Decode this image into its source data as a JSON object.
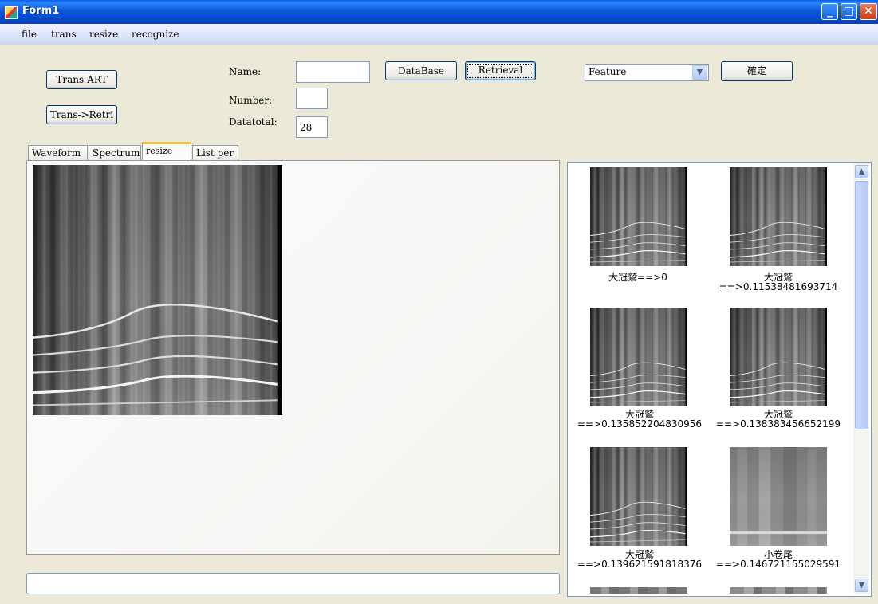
{
  "window": {
    "title": "Form1"
  },
  "menu": [
    "file",
    "trans",
    "resize",
    "recognize"
  ],
  "buttons": {
    "trans_art": "Trans-ART",
    "trans_retri": "Trans->Retri",
    "database": "DataBase",
    "retrieval": "Retrieval",
    "confirm": "確定"
  },
  "fields": {
    "name_label": "Name:",
    "name_value": "",
    "number_label": "Number:",
    "number_value": "",
    "datatotal_label": "Datatotal:",
    "datatotal_value": "28"
  },
  "feature_select": {
    "value": "Feature"
  },
  "tabs": [
    "Waveform",
    "Spectrum",
    "resize",
    "List per"
  ],
  "active_tab": "resize",
  "status_text": "",
  "results": [
    {
      "line1": "大冠鷲==>0",
      "line2": ""
    },
    {
      "line1": "大冠鷲",
      "line2": "==>0.11538481693714"
    },
    {
      "line1": "大冠鷲",
      "line2": "==>0.135852204830956"
    },
    {
      "line1": "大冠鷲",
      "line2": "==>0.138383456652199"
    },
    {
      "line1": "大冠鷲",
      "line2": "==>0.139621591818376"
    },
    {
      "line1": "小卷尾",
      "line2": "==>0.146721155029591"
    }
  ],
  "colors": {
    "titlebar": "#0a58d8",
    "window_bg": "#ece9d8",
    "tab_highlight": "#ffc83c"
  }
}
